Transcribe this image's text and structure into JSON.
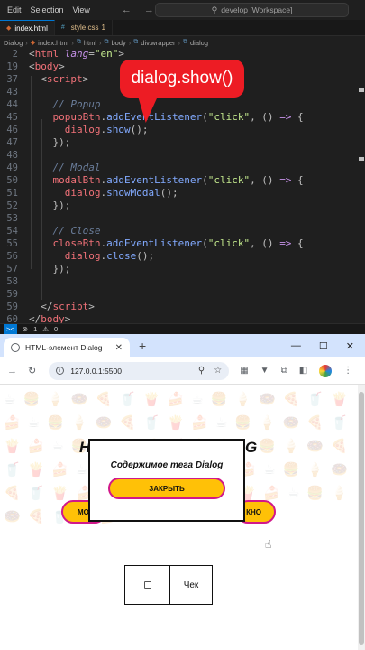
{
  "vscode": {
    "menu": [
      "Edit",
      "Selection",
      "View"
    ],
    "search": "develop [Workspace]",
    "tabs": [
      {
        "label": "index.html",
        "badge": ""
      },
      {
        "label": "style.css",
        "badge": "1"
      }
    ],
    "breadcrumb": [
      "Dialog",
      "index.html",
      "html",
      "body",
      "div.wrapper",
      "dialog"
    ],
    "line_numbers": [
      "2",
      "19",
      "37",
      "43",
      "44",
      "45",
      "46",
      "47",
      "48",
      "49",
      "50",
      "51",
      "52",
      "53",
      "54",
      "55",
      "56",
      "57",
      "58",
      "59",
      "60"
    ],
    "status": {
      "errors": "1",
      "warnings": "0"
    }
  },
  "callout": {
    "text": "dialog.show()"
  },
  "browser": {
    "tab_title": "HTML-элемент Dialog",
    "url": "127.0.0.1:5500",
    "page": {
      "heading_left": "H",
      "heading_right": "G",
      "pill_left": "МОД",
      "pill_right": "КНО",
      "dialog_text": "Содержимое тега Dialog",
      "dialog_button": "ЗАКРЫТЬ",
      "check_label": "Чек"
    }
  }
}
